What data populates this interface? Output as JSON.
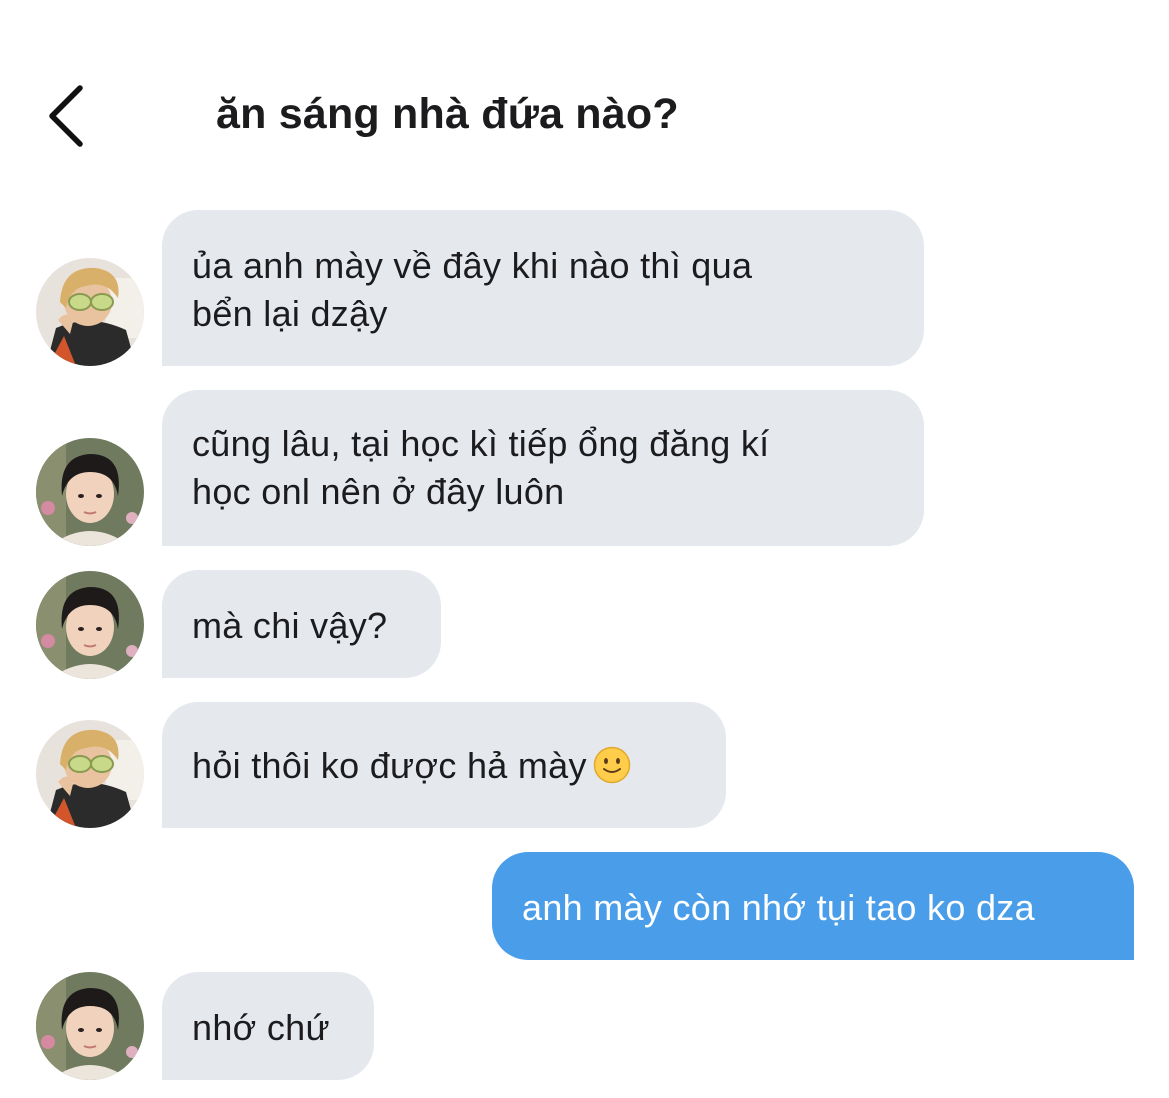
{
  "header": {
    "back_icon": "chevron-left-icon",
    "title": "ăn sáng nhà đứa nào?"
  },
  "messages": [
    {
      "side": "incoming",
      "avatar": "avatar-blonde-sunglasses",
      "lines": [
        "ủa anh mày về đây khi nào thì qua",
        "bển lại dzậy"
      ]
    },
    {
      "side": "incoming",
      "avatar": "avatar-dark-hair",
      "lines": [
        "cũng lâu, tại học kì tiếp ổng đăng kí",
        "học onl nên ở đây luôn"
      ]
    },
    {
      "side": "incoming",
      "avatar": "avatar-dark-hair",
      "lines": [
        "mà chi vậy?"
      ]
    },
    {
      "side": "incoming",
      "avatar": "avatar-blonde-sunglasses",
      "lines": [
        "hỏi thôi ko được hả mày"
      ],
      "emoji": "slightly-smiling-face-icon"
    },
    {
      "side": "outgoing",
      "lines": [
        "anh mày còn nhớ tụi tao ko dza"
      ]
    },
    {
      "side": "incoming",
      "avatar": "avatar-dark-hair",
      "lines": [
        "nhớ chứ"
      ]
    }
  ],
  "colors": {
    "incoming_bubble": "#e5e9ee",
    "outgoing_bubble": "#4a9ee9",
    "text": "#1c1c1e",
    "outgoing_text": "#ffffff"
  }
}
